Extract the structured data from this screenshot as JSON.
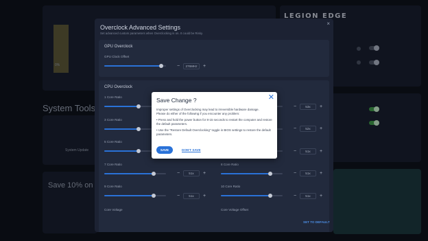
{
  "background": {
    "logo": "LEGION EDGE",
    "system_tools_title": "System Tools",
    "system_update_label": "System Update",
    "promo_text": "Save 10% on Le",
    "percent_text": "0%"
  },
  "overclock": {
    "title": "Overclock Advanced Settings",
    "subtitle": "Set advanced custom parameters when Overclocking is on. It could be Risky.",
    "gpu_section_title": "GPU Overclock",
    "gpu_clock_offset_label": "GPU Clock Offset",
    "gpu_clock_offset_value": "276MHz",
    "cpu_section_title": "CPU Overclock",
    "core_ratios": [
      {
        "label": "1 Core Ratio",
        "value": "",
        "level": 0.55
      },
      {
        "label": "",
        "value": "53x",
        "level": 0.8
      },
      {
        "label": "3 Core Ratio",
        "value": "",
        "level": 0.55
      },
      {
        "label": "",
        "value": "52x",
        "level": 0.8
      },
      {
        "label": "5 Core Ratio",
        "value": "",
        "level": 0.55
      },
      {
        "label": "",
        "value": "51x",
        "level": 0.8
      },
      {
        "label": "7 Core Ratio",
        "value": "51x",
        "level": 0.8
      },
      {
        "label": "8 Core Ratio",
        "value": "51x",
        "level": 0.8
      },
      {
        "label": "9 Core Ratio",
        "value": "51x",
        "level": 0.8
      },
      {
        "label": "10 Core Ratio",
        "value": "51x",
        "level": 0.8
      }
    ],
    "core_voltage_label": "Core Voltage",
    "core_voltage_offset_label": "Core Voltage Offset",
    "reset_label": "SET TO DEFAULT",
    "minus_glyph": "−",
    "plus_glyph": "+",
    "close_glyph": "×"
  },
  "dialog": {
    "title": "Save Change ?",
    "body_line1": "Improper settings of Overclocking may lead to irreversible hardware damage.",
    "body_line2": "Please do either of the following if you encounter any problem:",
    "bullet1": "• Press and hold the power button for 8-15 seconds to restart the computer and restore the default parameters.",
    "bullet2": "• Use the \"Restore Default Overclocking\" toggle in BIOS settings to restore the default parameters.",
    "save_label": "SAVE",
    "dont_save_label": "DON'T SAVE",
    "close_glyph": "✕"
  },
  "colors": {
    "accent": "#2a72d8",
    "panel": "#1c2233",
    "dialog_bg": "#ffffff",
    "toggle_on": "#3f9a4a"
  },
  "icons": [
    "close-icon",
    "plus-icon",
    "minus-icon"
  ]
}
